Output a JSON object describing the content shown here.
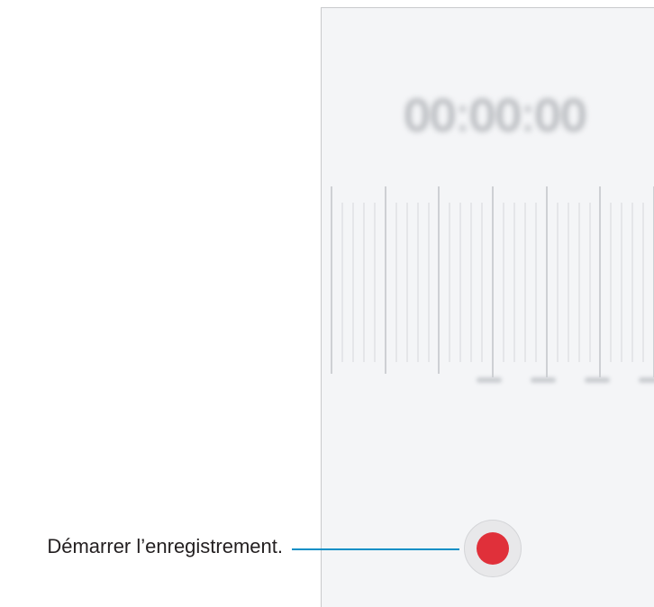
{
  "recorder": {
    "timer": "00:00:00",
    "scale_marks": [
      "",
      "",
      "",
      ""
    ],
    "record_button_icon": "record-icon",
    "record_color": "#e0303a"
  },
  "callout": {
    "text": "Démarrer l’enregistrement.",
    "line_color": "#0b8fc6"
  }
}
